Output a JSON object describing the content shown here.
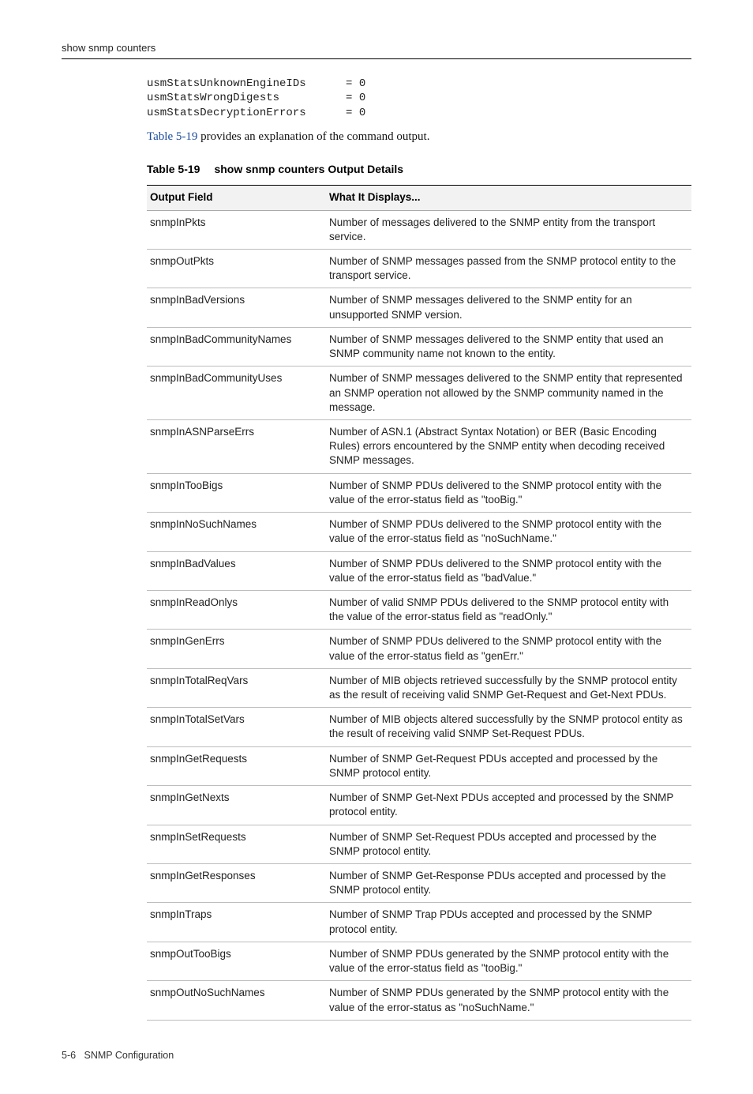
{
  "header": {
    "running_title": "show snmp counters"
  },
  "code": {
    "lines": [
      {
        "name": "usmStatsUnknownEngineIDs",
        "val": "= 0"
      },
      {
        "name": "usmStatsWrongDigests",
        "val": "= 0"
      },
      {
        "name": "usmStatsDecryptionErrors",
        "val": "= 0"
      }
    ]
  },
  "intro": {
    "link_text": "Table 5-19",
    "rest": " provides an explanation of the command output."
  },
  "table": {
    "caption_num": "Table 5-19",
    "caption_title": "show snmp counters Output Details",
    "head": {
      "col_a": "Output Field",
      "col_b": "What It Displays..."
    },
    "rows": [
      {
        "a": "snmpInPkts",
        "b": "Number of messages delivered to the SNMP entity from the transport service."
      },
      {
        "a": "snmpOutPkts",
        "b": "Number of SNMP messages passed from the SNMP protocol entity to the transport service."
      },
      {
        "a": "snmpInBadVersions",
        "b": "Number of SNMP messages delivered to the SNMP entity for an unsupported SNMP version."
      },
      {
        "a": "snmpInBadCommunityNames",
        "b": "Number of SNMP messages delivered to the SNMP entity that used an SNMP community name not known to the entity."
      },
      {
        "a": "snmpInBadCommunityUses",
        "b": "Number of SNMP messages delivered to the SNMP entity that represented an SNMP operation not allowed by the SNMP community named in the message."
      },
      {
        "a": "snmpInASNParseErrs",
        "b": "Number of ASN.1 (Abstract Syntax Notation) or BER (Basic Encoding Rules) errors encountered by the SNMP entity when decoding received SNMP messages."
      },
      {
        "a": "snmpInTooBigs",
        "b": "Number of SNMP PDUs delivered to the SNMP protocol entity with the value of the error-status field as \"tooBig.\""
      },
      {
        "a": "snmpInNoSuchNames",
        "b": "Number of SNMP PDUs delivered to the SNMP protocol entity with the value of the error-status field as \"noSuchName.\""
      },
      {
        "a": "snmpInBadValues",
        "b": "Number of SNMP PDUs delivered to the SNMP protocol entity with the value of the error-status field as \"badValue.\""
      },
      {
        "a": "snmpInReadOnlys",
        "b": "Number of valid SNMP PDUs delivered to the SNMP protocol entity with the value of the error-status field as \"readOnly.\""
      },
      {
        "a": "snmpInGenErrs",
        "b": "Number of SNMP PDUs delivered to the SNMP protocol entity with the value of the error-status field as \"genErr.\""
      },
      {
        "a": "snmpInTotalReqVars",
        "b": "Number of MIB objects retrieved successfully by the SNMP protocol entity as the result of receiving valid SNMP Get-Request and Get-Next PDUs."
      },
      {
        "a": "snmpInTotalSetVars",
        "b": "Number of MIB objects altered successfully by the SNMP protocol entity as the result of receiving valid SNMP Set-Request PDUs."
      },
      {
        "a": "snmpInGetRequests",
        "b": "Number of SNMP Get-Request PDUs accepted and processed by the SNMP protocol entity."
      },
      {
        "a": "snmpInGetNexts",
        "b": "Number of SNMP Get-Next PDUs accepted and processed by the SNMP protocol entity."
      },
      {
        "a": "snmpInSetRequests",
        "b": "Number of SNMP Set-Request PDUs accepted and processed by the SNMP protocol entity."
      },
      {
        "a": "snmpInGetResponses",
        "b": "Number of SNMP Get-Response PDUs accepted and processed by the SNMP protocol entity."
      },
      {
        "a": "snmpInTraps",
        "b": "Number of SNMP Trap PDUs accepted and processed by the SNMP protocol entity."
      },
      {
        "a": "snmpOutTooBigs",
        "b": "Number of SNMP PDUs generated by the SNMP protocol entity with the value of the error-status field as \"tooBig.\""
      },
      {
        "a": "snmpOutNoSuchNames",
        "b": "Number of SNMP PDUs generated by the SNMP protocol entity with the value of the error-status as \"noSuchName.\""
      }
    ]
  },
  "footer": {
    "page_num": "5-6",
    "section": "SNMP Configuration"
  }
}
